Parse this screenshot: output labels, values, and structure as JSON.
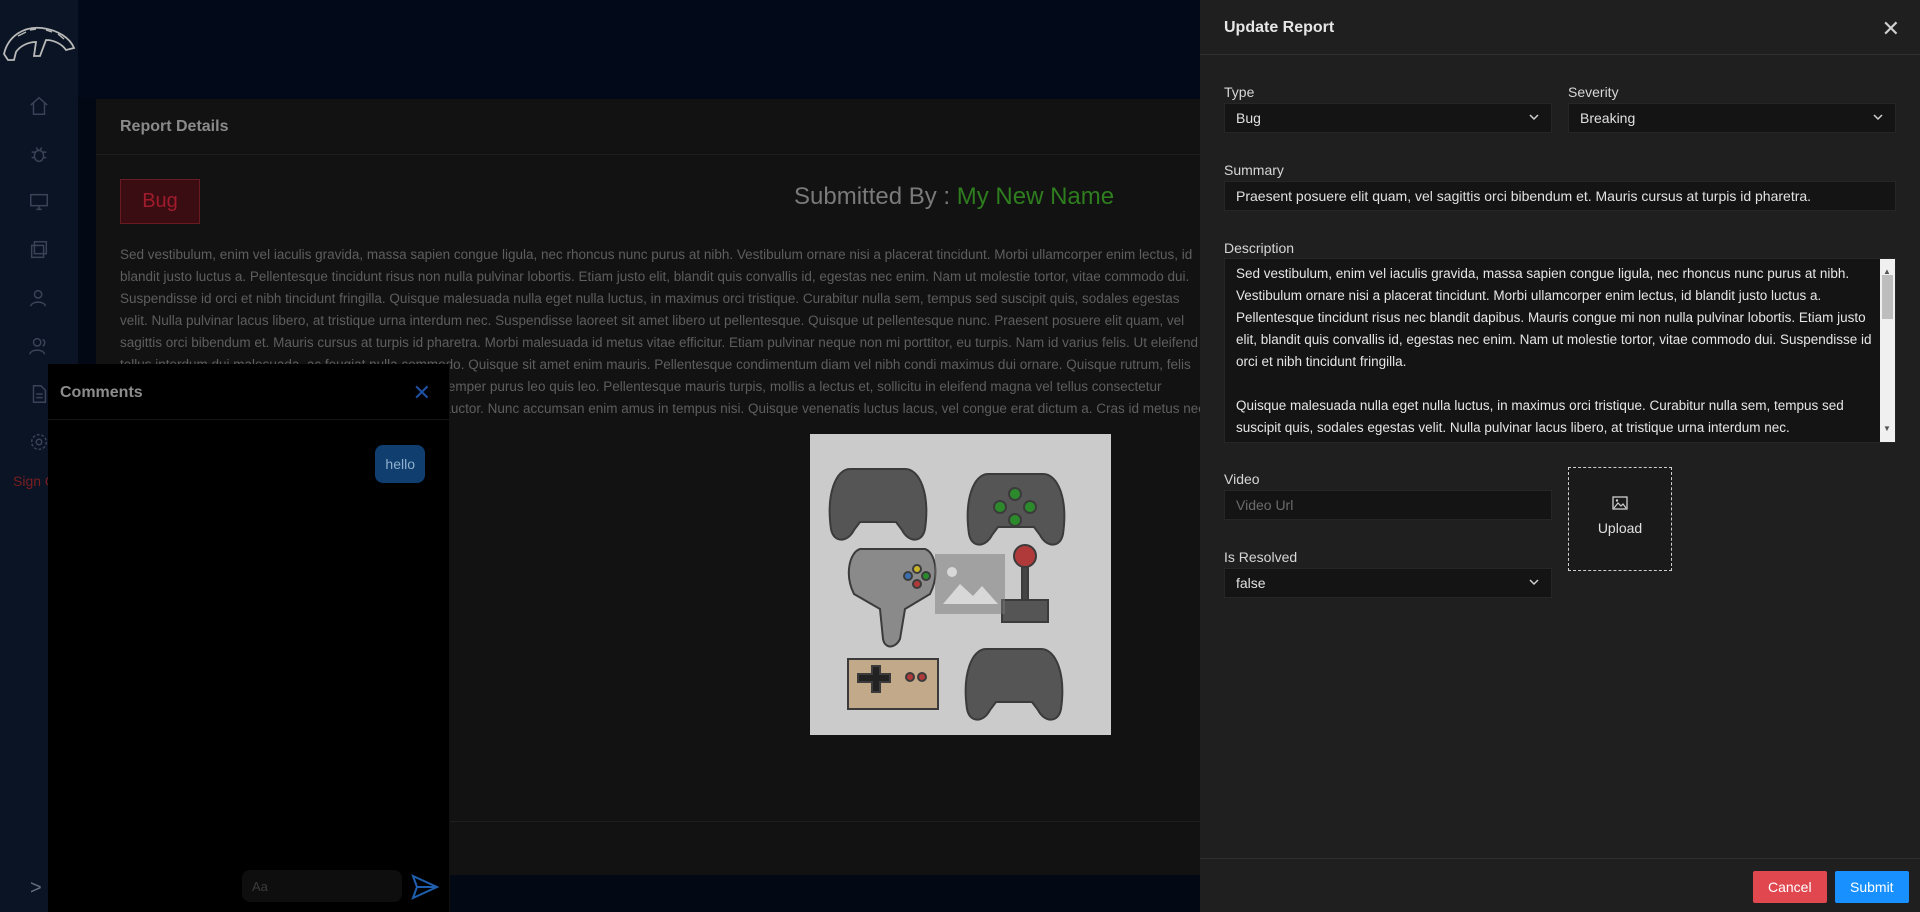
{
  "sidebar": {
    "items": [
      {
        "icon": "home-icon"
      },
      {
        "icon": "bug-icon"
      },
      {
        "icon": "monitor-icon"
      },
      {
        "icon": "layers-icon"
      },
      {
        "icon": "user-icon"
      },
      {
        "icon": "users-icon"
      },
      {
        "icon": "document-icon"
      },
      {
        "icon": "gear-icon"
      }
    ],
    "sign_out_label": "Sign O",
    "collapse_label": ">"
  },
  "report": {
    "title": "Report Details",
    "type_tag": "Bug",
    "submitted_by_label": "Submitted By : ",
    "submitted_by_name": "My New Name",
    "body": "Sed vestibulum, enim vel iaculis gravida, massa sapien congue ligula, nec rhoncus nunc purus at nibh. Vestibulum ornare nisi a placerat tincidunt. Morbi ullamcorper enim lectus, id blandit justo luctus a. Pellentesque tincidunt risus non nulla pulvinar lobortis. Etiam justo elit, blandit quis convallis id, egestas nec enim. Nam ut molestie tortor, vitae commodo dui. Suspendisse id orci et nibh tincidunt fringilla. Quisque malesuada nulla eget nulla luctus, in maximus orci tristique. Curabitur nulla sem, tempus sed suscipit quis, sodales egestas velit. Nulla pulvinar lacus libero, at tristique urna interdum nec. Suspendisse laoreet sit amet libero ut pellentesque. Quisque ut pellentesque nunc. Praesent posuere elit quam, vel sagittis orci bibendum et. Mauris cursus at turpis id pharetra. Morbi malesuada id metus vitae efficitur. Etiam pulvinar neque non mi porttitor, eu turpis. Nam id varius felis. Ut eleifend tellus interdum dui malesuada, ac feugiat nulla commodo. Quisque sit amet enim mauris. Pellentesque condimentum diam vel nibh condi maximus dui ornare. Quisque rutrum, felis nec scelerisque molestie, nisi tellus tristique enim, eu semper purus leo quis leo. Pellentesque mauris turpis, mollis a lectus et, sollicitu in eleifend magna vel tellus consectetur fermentum. Etiam nec augue quis mauris consectetur auctor. Nunc accumsan enim amus in tempus nisi. Quisque venenatis luctus lacus, vel congue erat dictum a. Cras id metus nec nibh ullamcorper molesti"
  },
  "comments": {
    "title": "Comments",
    "close_icon": "close-icon",
    "messages": [
      {
        "text": "hello"
      }
    ],
    "input_placeholder": "Aa",
    "send_icon": "send-icon"
  },
  "drawer": {
    "title": "Update Report",
    "type": {
      "label": "Type",
      "value": "Bug"
    },
    "severity": {
      "label": "Severity",
      "value": "Breaking"
    },
    "summary": {
      "label": "Summary",
      "value": "Praesent posuere elit quam, vel sagittis orci bibendum et. Mauris cursus at turpis id pharetra."
    },
    "description": {
      "label": "Description",
      "para1": "Sed vestibulum, enim vel iaculis gravida, massa sapien congue ligula, nec rhoncus nunc purus at nibh. Vestibulum ornare nisi a placerat tincidunt. Morbi ullamcorper enim lectus, id blandit justo luctus a. Pellentesque tincidunt risus nec blandit dapibus. Mauris congue mi non nulla pulvinar lobortis. Etiam justo elit, blandit quis convallis id, egestas nec enim. Nam ut molestie tortor, vitae commodo dui. Suspendisse id orci et nibh tincidunt fringilla.",
      "para2": "Quisque malesuada nulla eget nulla luctus, in maximus orci tristique. Curabitur nulla sem, tempus sed suscipit quis, sodales egestas velit. Nulla pulvinar lacus libero, at tristique urna interdum nec."
    },
    "video": {
      "label": "Video",
      "placeholder": "Video Url"
    },
    "upload_label": "Upload",
    "is_resolved": {
      "label": "Is Resolved",
      "value": "false"
    },
    "cancel_label": "Cancel",
    "submit_label": "Submit"
  },
  "colors": {
    "accent": "#1890ff",
    "danger": "#e0474f",
    "submitted_name": "#2e7d1e",
    "bug_tag": "#a01c2c"
  }
}
